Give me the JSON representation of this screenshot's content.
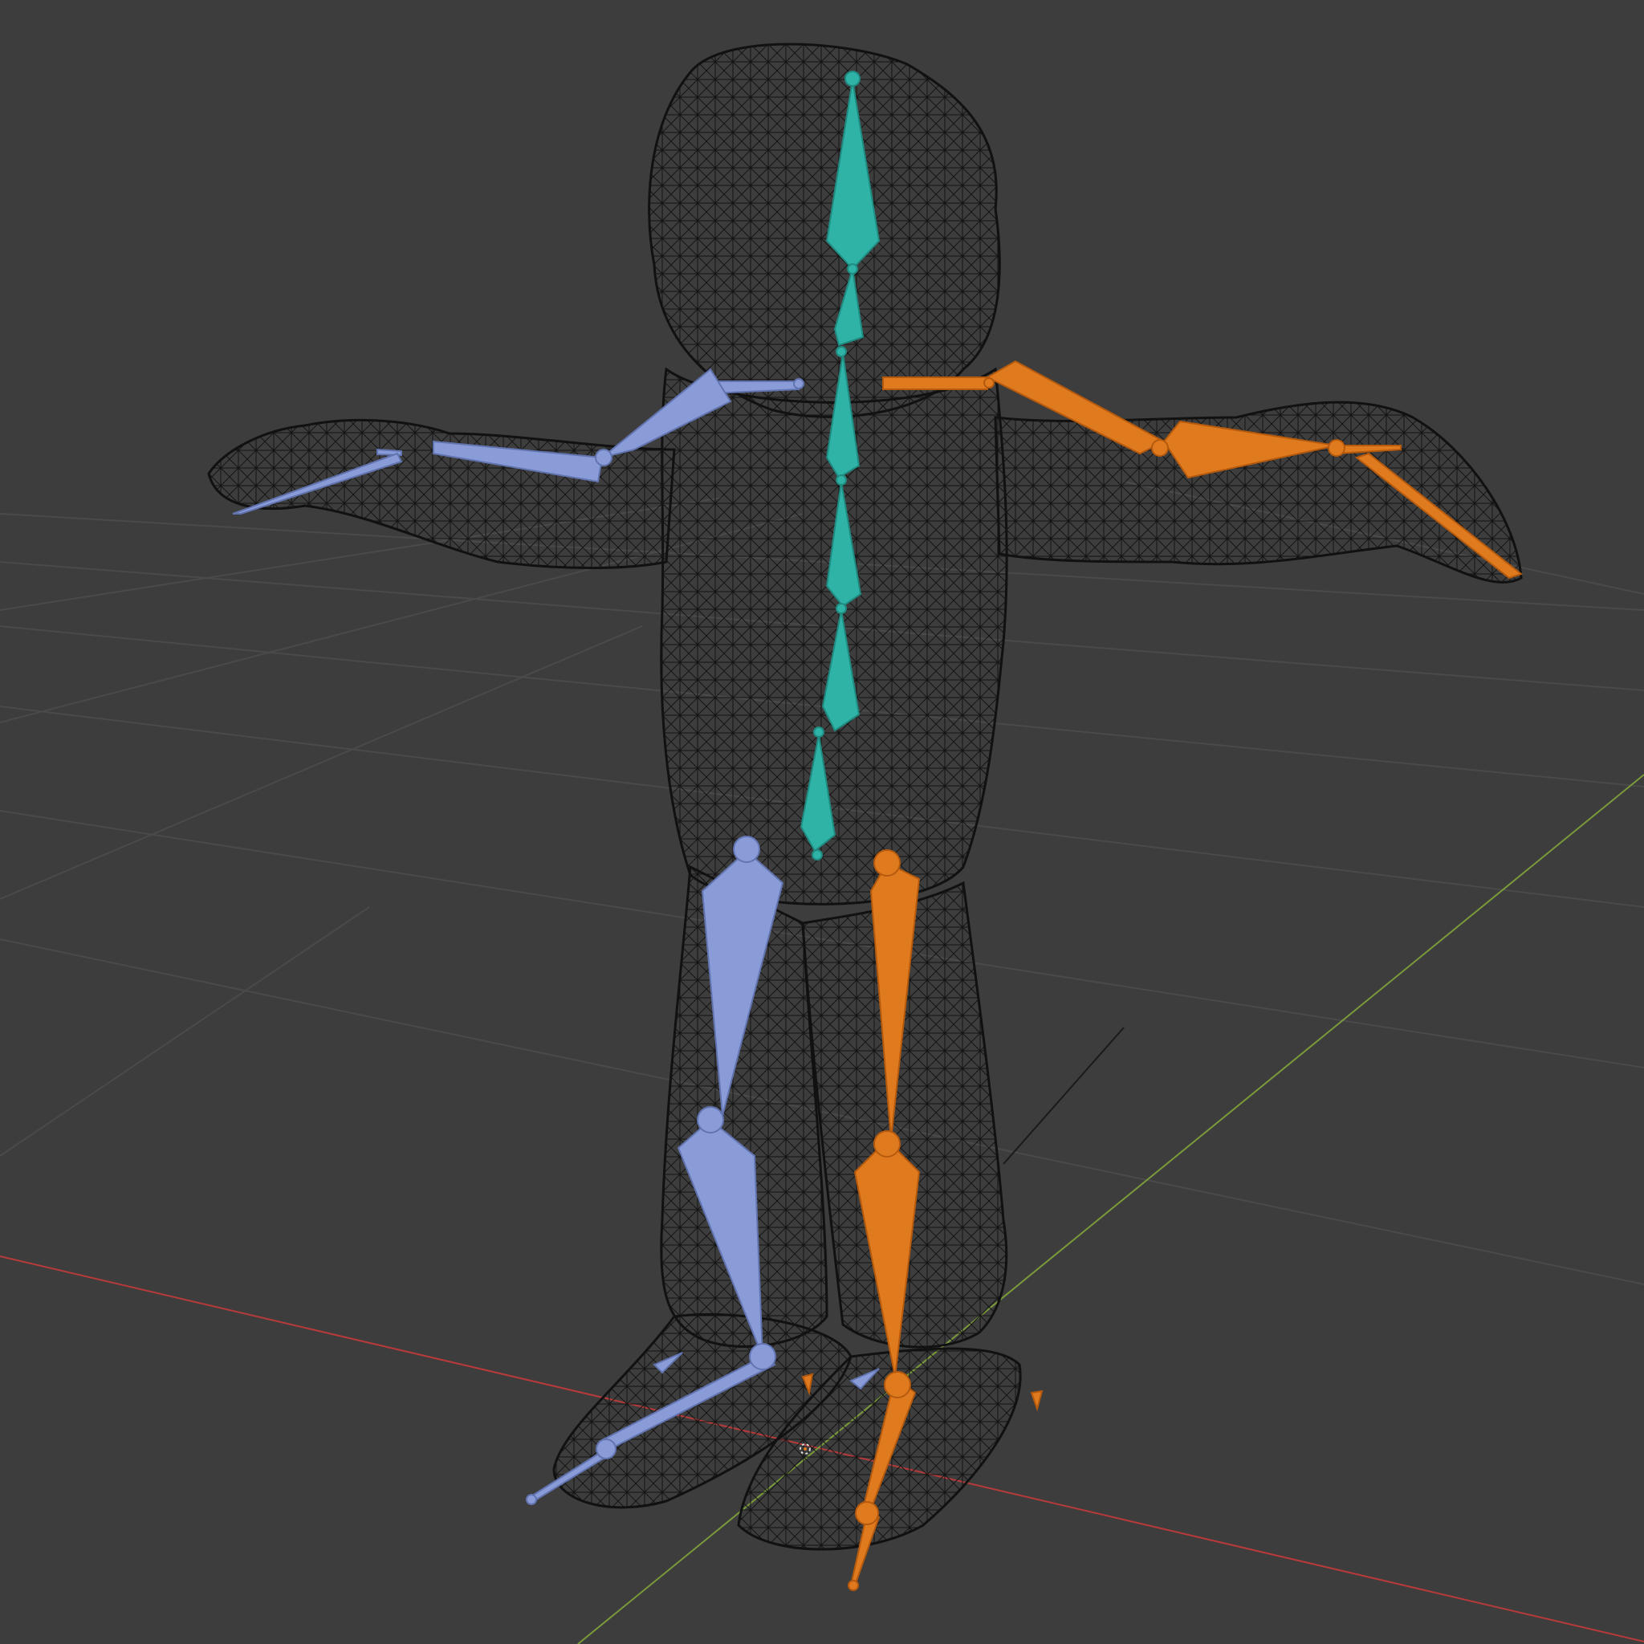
{
  "viewport": {
    "background": "#3d3d3d",
    "grid_color": "#4a4a4a",
    "x_axis_color": "#b83a3a",
    "y_axis_color": "#7a9a3a",
    "mesh_color": "#111111"
  },
  "armature": {
    "colors": {
      "spine": "#2fb3a6",
      "spine_dark": "#1f8a80",
      "left": "#8a9cd8",
      "left_dark": "#6274b0",
      "right": "#e07a1f",
      "right_dark": "#b55a0d"
    },
    "bone_groups": [
      "spine",
      "left",
      "right"
    ]
  },
  "scene": {
    "mode": "wireframe",
    "object": "armature-over-character-mesh"
  }
}
